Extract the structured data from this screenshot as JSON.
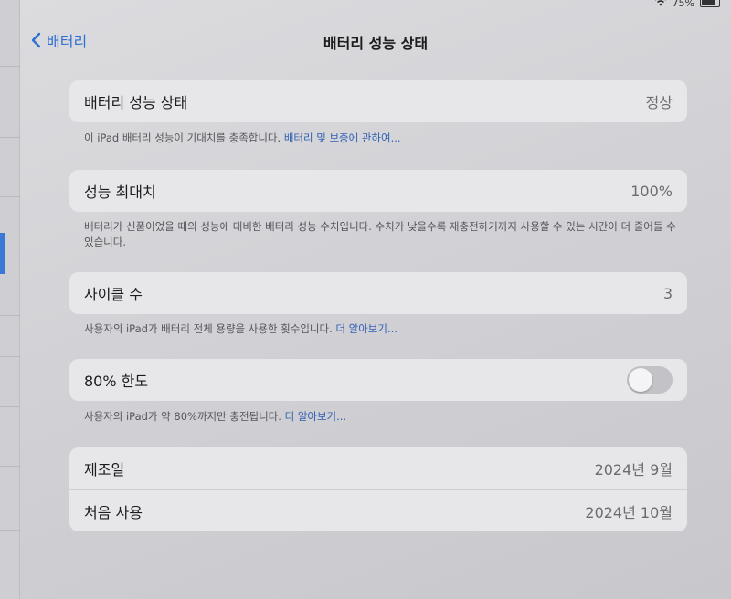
{
  "status": {
    "battery_text": "75%"
  },
  "nav": {
    "back_label": "배터리",
    "title": "배터리 성능 상태"
  },
  "health": {
    "label": "배터리 성능 상태",
    "value": "정상",
    "footnote_text": "이 iPad 배터리 성능이 기대치를 충족합니다. ",
    "footnote_link": "배터리 및 보증에 관하여..."
  },
  "max_capacity": {
    "label": "성능 최대치",
    "value": "100%",
    "footnote": "배터리가 신품이었을 때의 성능에 대비한 배터리 성능 수치입니다. 수치가 낮을수록 재충전하기까지 사용할 수 있는 시간이 더 줄어들 수 있습니다."
  },
  "cycle_count": {
    "label": "사이클 수",
    "value": "3",
    "footnote_text": "사용자의 iPad가 배터리 전체 용량을 사용한 횟수입니다. ",
    "footnote_link": "더 알아보기..."
  },
  "limit_80": {
    "label": "80% 한도",
    "enabled": false,
    "footnote_text": "사용자의 iPad가 약 80%까지만 충전됩니다. ",
    "footnote_link": "더 알아보기..."
  },
  "dates": {
    "manufactured_label": "제조일",
    "manufactured_value": "2024년 9월",
    "first_use_label": "처음 사용",
    "first_use_value": "2024년 10월"
  }
}
